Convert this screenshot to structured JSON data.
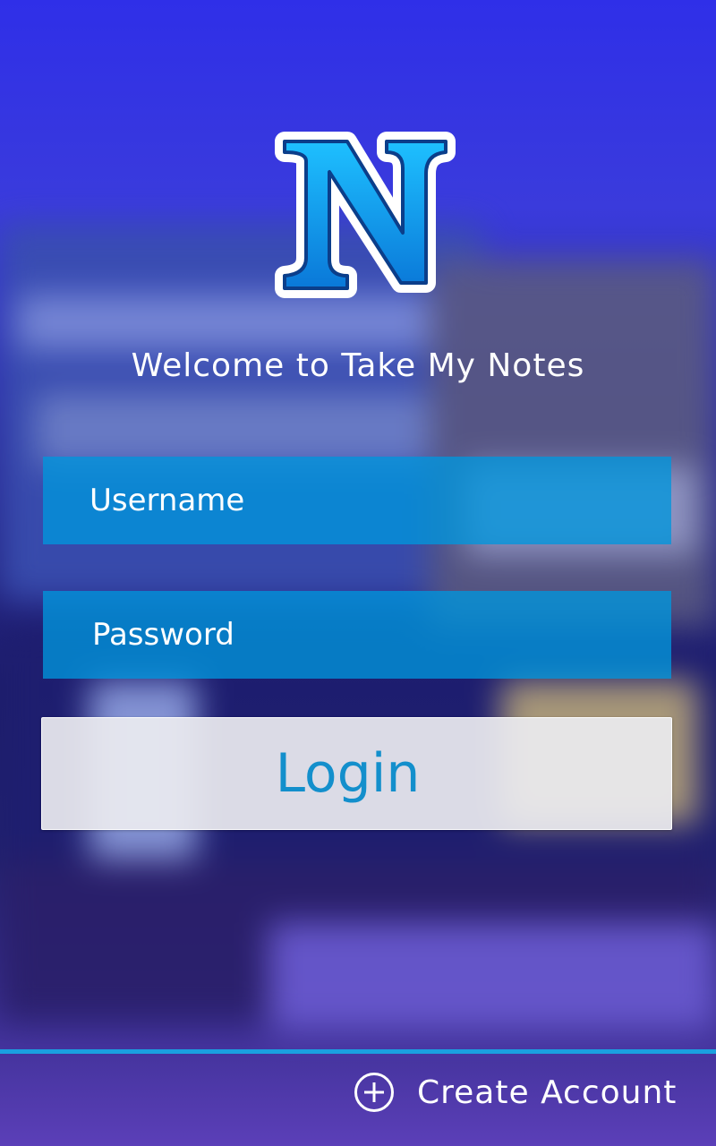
{
  "app": {
    "logo_letter": "N",
    "welcome_text": "Welcome to Take My Notes"
  },
  "form": {
    "username_placeholder": "Username",
    "password_placeholder": "Password",
    "login_label": "Login"
  },
  "footer": {
    "create_account_label": "Create Account",
    "create_account_icon": "plus-circle-icon"
  },
  "colors": {
    "accent": "#1aa0e0",
    "field_bg": "#0096dc",
    "login_text": "#138fcc"
  }
}
